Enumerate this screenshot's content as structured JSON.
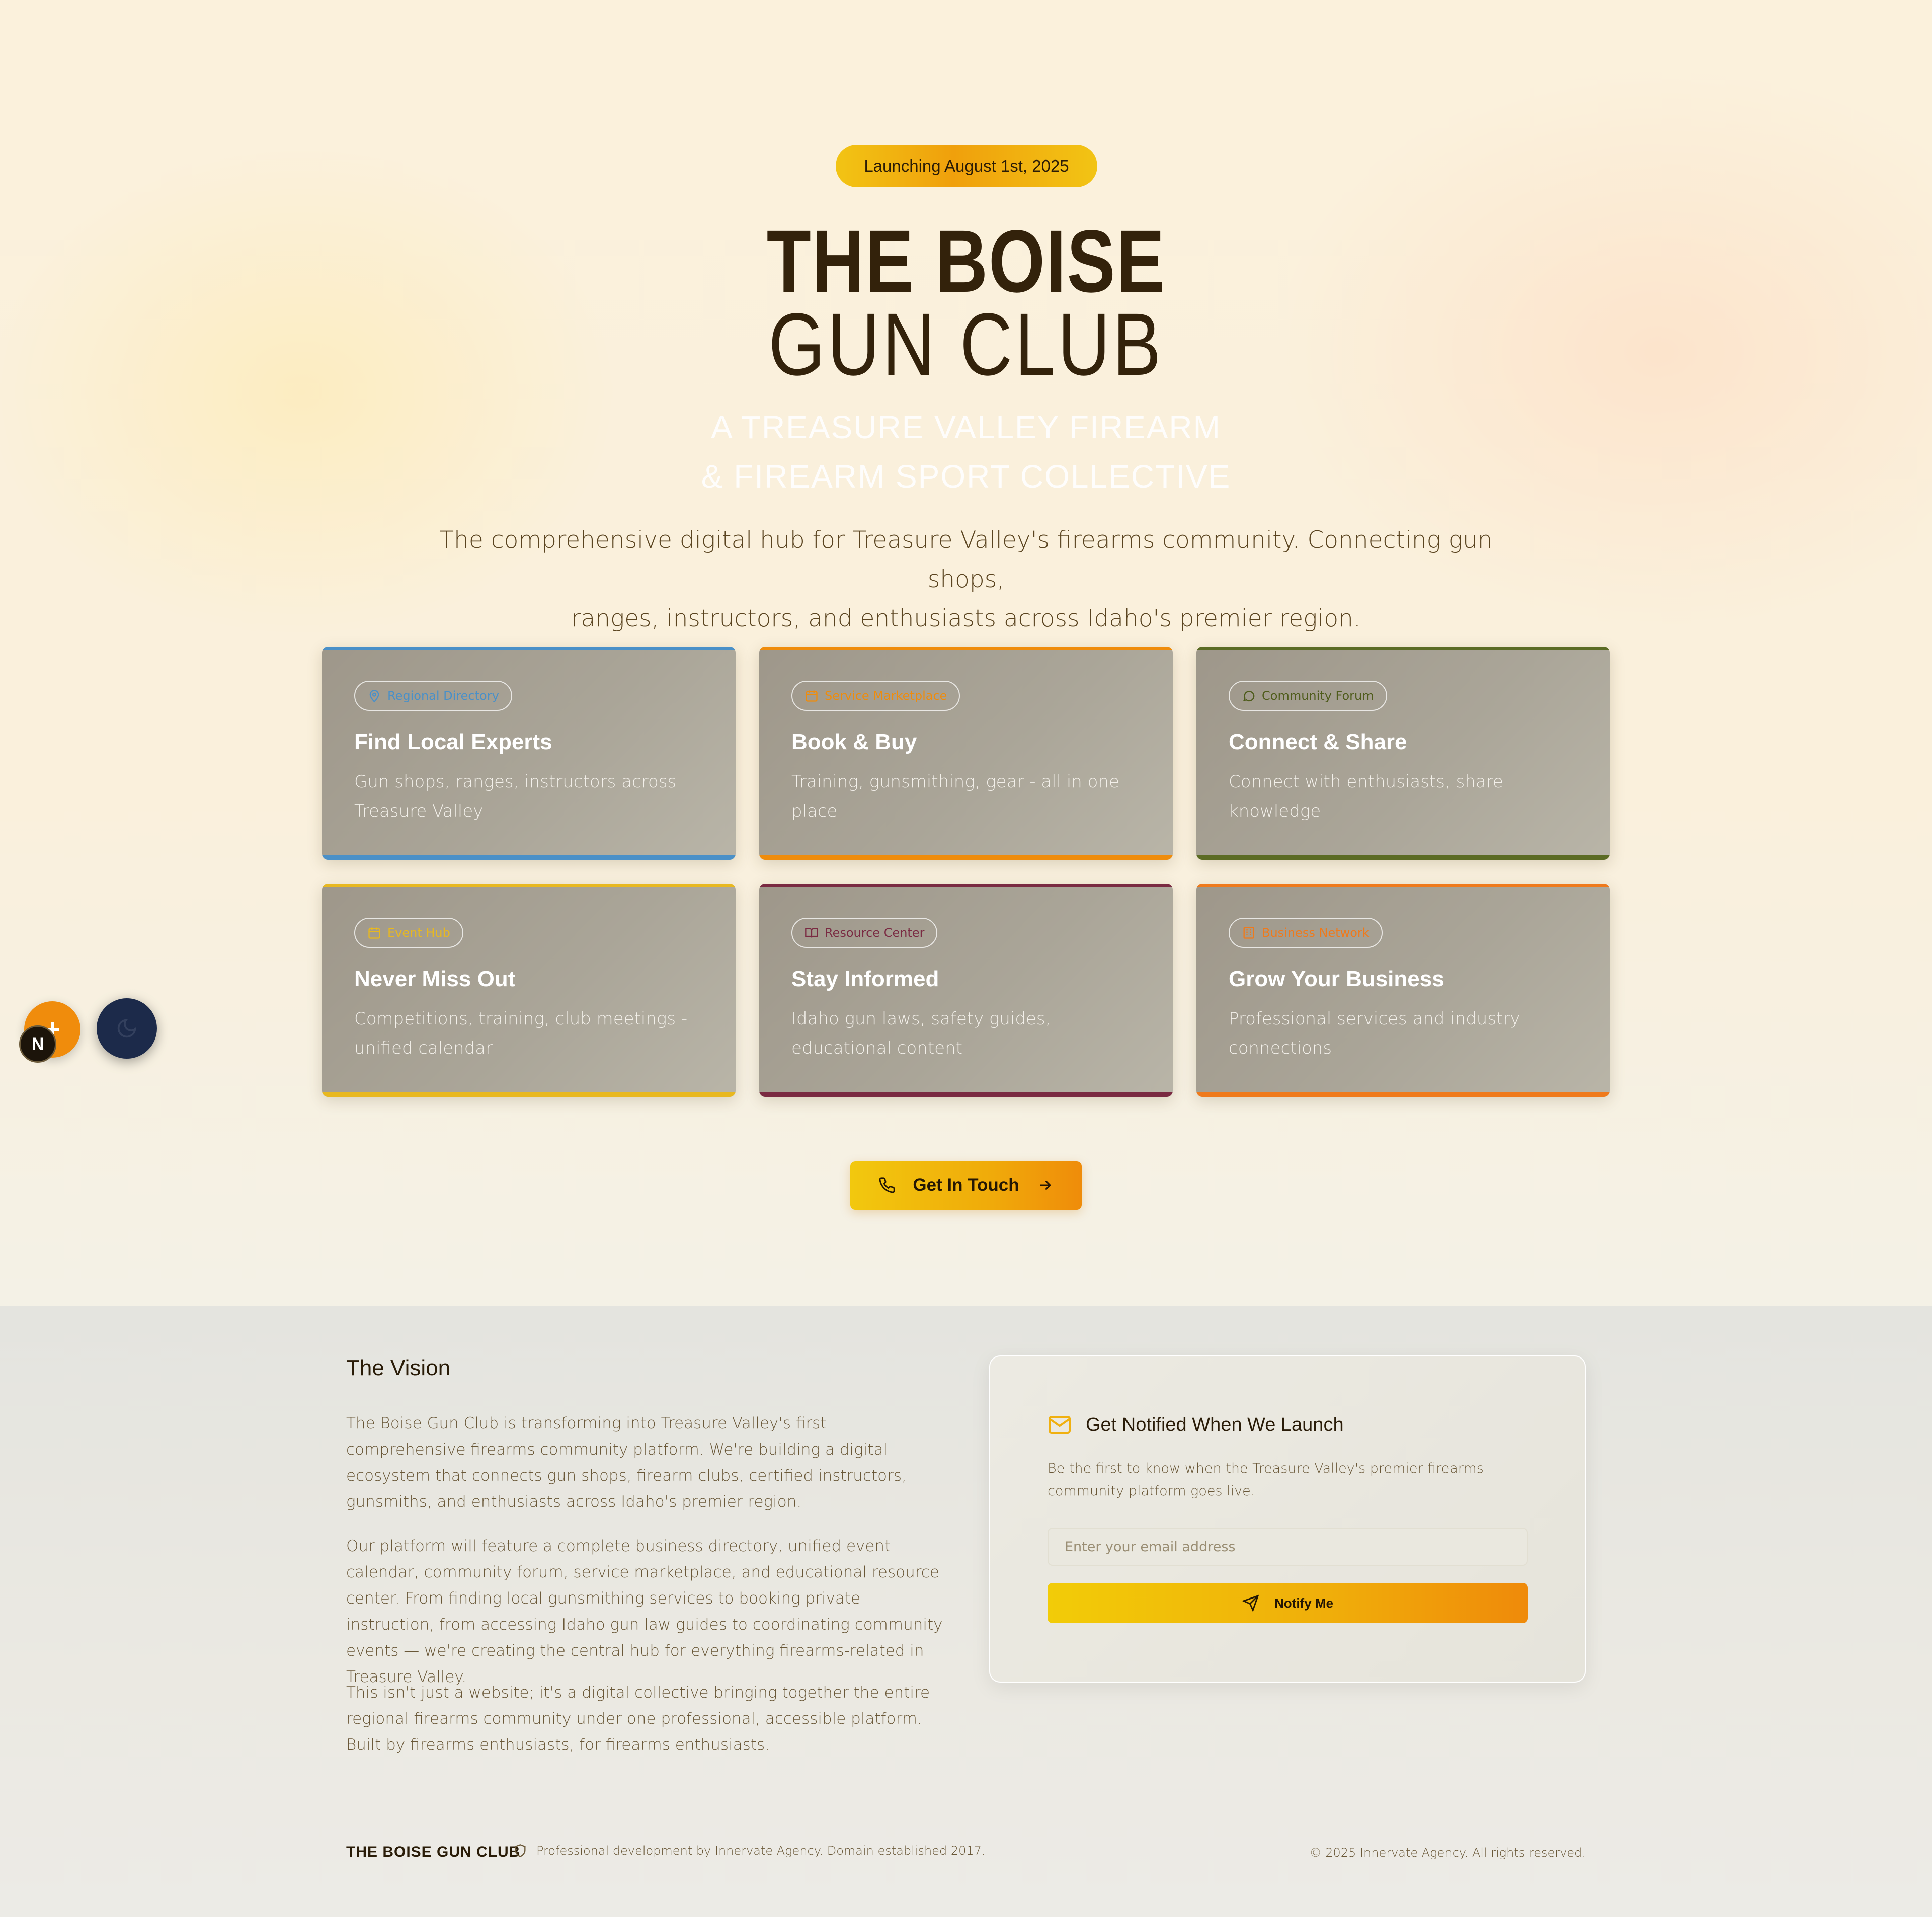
{
  "hero": {
    "launch_badge": "Launching August 1st, 2025",
    "title_line1": "THE BOISE",
    "title_line2": "GUN CLUB",
    "tagline_line1": "A TREASURE VALLEY FIREARM",
    "tagline_line2": "& FIREARM SPORT COLLECTIVE",
    "intro_line1": "The comprehensive digital hub for Treasure Valley's firearms community. Connecting gun shops,",
    "intro_line2": "ranges, instructors, and enthusiasts across Idaho's premier region."
  },
  "features": [
    {
      "chip": "Regional Directory",
      "icon": "map-pin-icon",
      "title": "Find Local Experts",
      "desc": "Gun shops, ranges, instructors across Treasure Valley",
      "accent": "#4a90c8"
    },
    {
      "chip": "Service Marketplace",
      "icon": "calendar-icon",
      "title": "Book & Buy",
      "desc": "Training, gunsmithing, gear - all in one place",
      "accent": "#ef8c0c"
    },
    {
      "chip": "Community Forum",
      "icon": "chat-bubble-icon",
      "title": "Connect & Share",
      "desc": "Connect with enthusiasts, share knowledge",
      "accent": "#5b6b24"
    },
    {
      "chip": "Event Hub",
      "icon": "calendar-icon",
      "title": "Never Miss Out",
      "desc": "Competitions, training, club meetings - unified calendar",
      "accent": "#e8b820"
    },
    {
      "chip": "Resource Center",
      "icon": "book-icon",
      "title": "Stay Informed",
      "desc": "Idaho gun laws, safety guides, educational content",
      "accent": "#7a2a42"
    },
    {
      "chip": "Business Network",
      "icon": "building-icon",
      "title": "Grow Your Business",
      "desc": "Professional services and industry connections",
      "accent": "#ef7a1c"
    }
  ],
  "cta": {
    "label": "Get In Touch",
    "icon": "phone-icon",
    "trailing_icon": "arrow-right-icon"
  },
  "floating": {
    "plus_icon": "plus-icon",
    "badge_letter": "N",
    "theme_toggle_icon": "moon-icon"
  },
  "vision": {
    "title": "The Vision",
    "paragraphs": [
      "The Boise Gun Club is transforming into Treasure Valley's first comprehensive firearms community platform. We're building a digital ecosystem that connects gun shops, firearm clubs, certified instructors, gunsmiths, and enthusiasts across Idaho's premier region.",
      "Our platform will feature a complete business directory, unified event calendar, community forum, service marketplace, and educational resource center. From finding local gunsmithing services to booking private instruction, from accessing Idaho gun law guides to coordinating community events — we're creating the central hub for everything firearms-related in Treasure Valley.",
      "This isn't just a website; it's a digital collective bringing together the entire regional firearms community under one professional, accessible platform. Built by firearms enthusiasts, for firearms enthusiasts."
    ]
  },
  "notify": {
    "title": "Get Notified When We Launch",
    "icon": "mail-icon",
    "desc": "Be the first to know when the Treasure Valley's premier firearms community platform goes live.",
    "email_placeholder": "Enter your email address",
    "button_label": "Notify Me",
    "button_icon": "send-icon"
  },
  "footer": {
    "brand": "THE BOISE GUN CLUB",
    "note": "Professional development by Innervate Agency. Domain established 2017.",
    "note_icon": "shield-icon",
    "copyright": "© 2025 Innervate Agency. All rights reserved."
  },
  "colors": {
    "brand_yellow": "#f2c414",
    "brand_orange": "#ef8c0c",
    "dark_brown": "#33220b"
  }
}
